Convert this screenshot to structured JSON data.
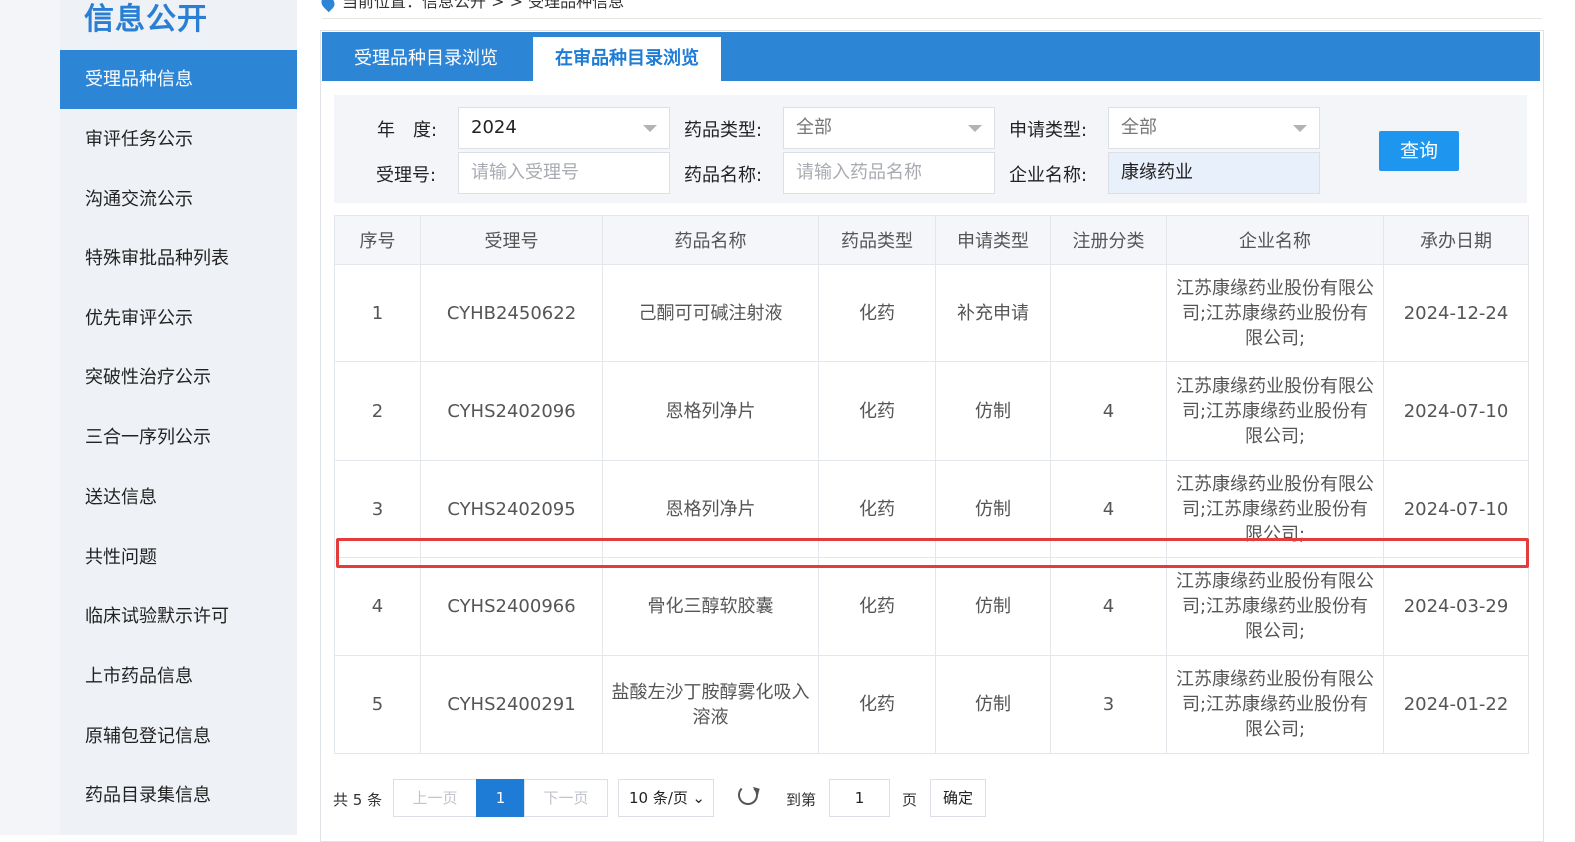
{
  "sidebar": {
    "title": "信息公开",
    "items": [
      "受理品种信息",
      "审评任务公示",
      "沟通交流公示",
      "特殊审批品种列表",
      "优先审评公示",
      "突破性治疗公示",
      "三合一序列公示",
      "送达信息",
      "共性问题",
      "临床试验默示许可",
      "上市药品信息",
      "原辅包登记信息",
      "药品目录集信息"
    ]
  },
  "breadcrumb": "当前位置：信息公开 > > 受理品种信息",
  "tabs": [
    "受理品种目录浏览",
    "在审品种目录浏览"
  ],
  "filters": {
    "year_label": "年　度:",
    "year_value": "2024",
    "drug_type_label": "药品类型:",
    "drug_type_value": "全部",
    "apply_type_label": "申请类型:",
    "apply_type_value": "全部",
    "accept_no_label": "受理号:",
    "accept_no_placeholder": "请输入受理号",
    "drug_name_label": "药品名称:",
    "drug_name_placeholder": "请输入药品名称",
    "company_label": "企业名称:",
    "company_value": "康缘药业",
    "query_button": "查询"
  },
  "table": {
    "headers": [
      "序号",
      "受理号",
      "药品名称",
      "药品类型",
      "申请类型",
      "注册分类",
      "企业名称",
      "承办日期"
    ],
    "rows": [
      [
        "1",
        "CYHB2450622",
        "己酮可可碱注射液",
        "化药",
        "补充申请",
        "",
        "江苏康缘药业股份有限公司;江苏康缘药业股份有限公司;",
        "2024-12-24"
      ],
      [
        "2",
        "CYHS2402096",
        "恩格列净片",
        "化药",
        "仿制",
        "4",
        "江苏康缘药业股份有限公司;江苏康缘药业股份有限公司;",
        "2024-07-10"
      ],
      [
        "3",
        "CYHS2402095",
        "恩格列净片",
        "化药",
        "仿制",
        "4",
        "江苏康缘药业股份有限公司;江苏康缘药业股份有限公司;",
        "2024-07-10"
      ],
      [
        "4",
        "CYHS2400966",
        "骨化三醇软胶囊",
        "化药",
        "仿制",
        "4",
        "江苏康缘药业股份有限公司;江苏康缘药业股份有限公司;",
        "2024-03-29"
      ],
      [
        "5",
        "CYHS2400291",
        "盐酸左沙丁胺醇雾化吸入溶液",
        "化药",
        "仿制",
        "3",
        "江苏康缘药业股份有限公司;江苏康缘药业股份有限公司;",
        "2024-01-22"
      ]
    ]
  },
  "pagination": {
    "total": "共 5 条",
    "prev": "上一页",
    "current": "1",
    "next": "下一页",
    "page_size": "10 条/页",
    "goto_label": "到第",
    "goto_value": "1",
    "page_label": "页",
    "confirm": "确定"
  }
}
